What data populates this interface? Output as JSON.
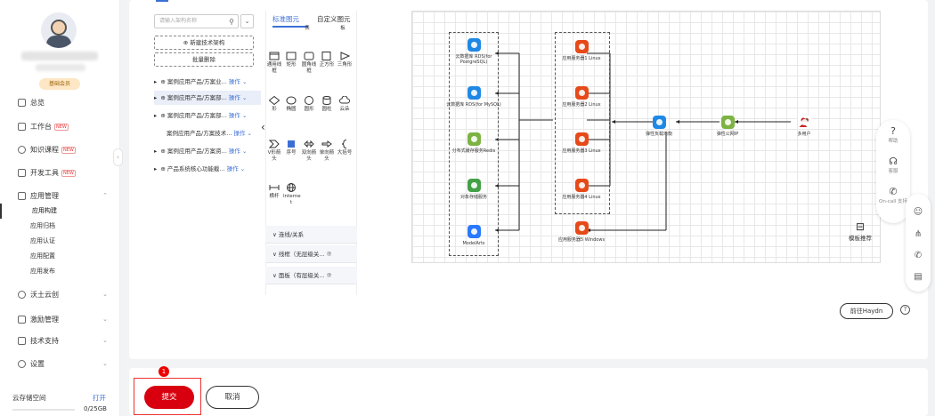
{
  "sidebar": {
    "badge": "基础会员",
    "nav": [
      {
        "label": "总览"
      },
      {
        "label": "工作台",
        "new": "NEW"
      },
      {
        "label": "知识课程",
        "new": "NEW"
      },
      {
        "label": "开发工具",
        "new": "NEW"
      },
      {
        "label": "应用管理"
      }
    ],
    "sub": [
      "应用构建",
      "应用归档",
      "应用认证",
      "应用配置",
      "应用发布"
    ],
    "nav2": [
      {
        "label": "沃土云创"
      },
      {
        "label": "激励管理"
      },
      {
        "label": "技术支持"
      },
      {
        "label": "设置"
      }
    ],
    "storage_label": "云存储空间",
    "open_label": "打开",
    "quota": "0/25GB"
  },
  "tree": {
    "search_placeholder": "请输入架构名称",
    "new_btn": "⊕ 新建技术架构",
    "batch_delete": "批量删除",
    "items": [
      {
        "label": "⊕ 案例应用产品/方案业...",
        "op": "操作 ⌄"
      },
      {
        "label": "⊕ 案例应用产品/方案部...",
        "op": "操作 ⌄"
      },
      {
        "label": "⊕ 案例应用产品/方案部...",
        "op": "操作 ⌄"
      },
      {
        "label": "案例应用产品/方案技术...",
        "op": "操作 ⌄"
      },
      {
        "label": "⊕ 案例应用产品/方案资...",
        "op": "操作 ⌄"
      },
      {
        "label": "⊕ 产品系统核心功能截...",
        "op": "操作 ⌄"
      }
    ]
  },
  "palette": {
    "tab1": "标准图元",
    "tab2": "自定义图元",
    "tab_sub": [
      "表",
      "板"
    ],
    "shapes_row1": [
      "通用线框",
      "矩形",
      "圆角线框",
      "正方形",
      "三角形"
    ],
    "shapes_row2": [
      "形",
      "椭圆",
      "圆形",
      "圆柱",
      "云朵"
    ],
    "shapes_row3": [
      "V形箭头",
      "序号",
      "双向箭头",
      "单向箭头",
      "大括号"
    ],
    "shapes_row4": [
      "横杆",
      "Interne t"
    ],
    "accordions": [
      "∨  连线/关系",
      "∨  线框（无层级关... ⑦",
      "∨  面板（有层级关... ⑦"
    ]
  },
  "diagram": {
    "left_nodes": [
      {
        "label": "云数据库 RDS(for PostgreSQL)",
        "color": "#1e88e5"
      },
      {
        "label": "云数据库 RDS(for MySQL)",
        "color": "#1e88e5"
      },
      {
        "label": "分布式缓存服务Redis",
        "color": "#7cb342"
      },
      {
        "label": "对象存储服务",
        "color": "#43a047"
      },
      {
        "label": "ModelArts",
        "color": "#2979ff"
      }
    ],
    "servers": [
      {
        "label": "应用服务器1 Linux",
        "color": "#e64a19"
      },
      {
        "label": "应用服务器2 Linux",
        "color": "#e64a19"
      },
      {
        "label": "应用服务器3 Linux",
        "color": "#e64a19"
      },
      {
        "label": "应用服务器4 Linux",
        "color": "#e64a19"
      },
      {
        "label": "应用服务器5 Windows",
        "color": "#e64a19"
      }
    ],
    "elb": {
      "label": "弹性负载均衡",
      "color": "#1e88e5"
    },
    "eip": {
      "label": "弹性公网IP",
      "color": "#7cb342"
    },
    "users": {
      "label": "多用户",
      "color": "#c62828"
    }
  },
  "help": {
    "items": [
      "帮助",
      "客服",
      "On-call 支持"
    ]
  },
  "template_label": "模板推荐",
  "haydn_label": "前往Haydn",
  "submit_label": "提交",
  "cancel_label": "取消",
  "notice_count": "1"
}
